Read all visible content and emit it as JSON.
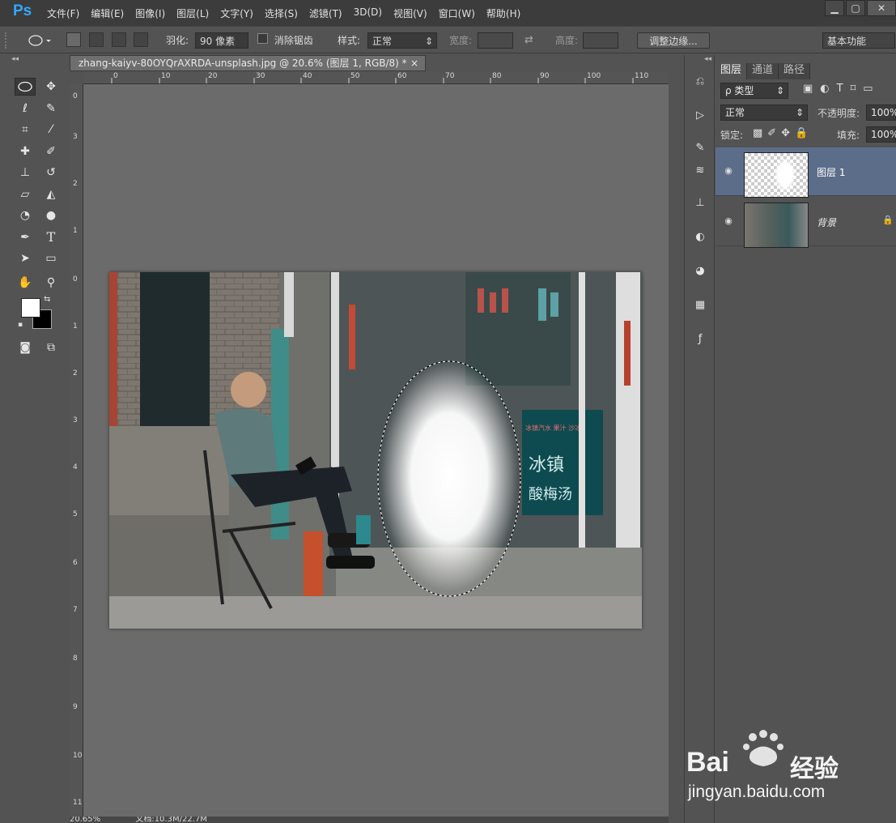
{
  "app": {
    "logo": "Ps",
    "menu": [
      "文件(F)",
      "编辑(E)",
      "图像(I)",
      "图层(L)",
      "文字(Y)",
      "选择(S)",
      "滤镜(T)",
      "3D(D)",
      "视图(V)",
      "窗口(W)",
      "帮助(H)"
    ],
    "window_buttons": [
      "▁",
      "▢",
      "✕"
    ]
  },
  "options": {
    "feather_label": "羽化:",
    "feather_value": "90 像素",
    "antialias_label": "消除锯齿",
    "style_label": "样式:",
    "style_value": "正常",
    "width_label": "宽度:",
    "height_label": "高度:",
    "refine_edge": "调整边缘...",
    "workspace": "基本功能"
  },
  "document": {
    "tab_title": "zhang-kaiyv-80OYQrAXRDA-unsplash.jpg  @ 20.6% (图层 1, RGB/8) *",
    "close": "×",
    "status": "20.65%",
    "status_doc": "文档:10.3M/22.7M",
    "ruler_top": [
      "0",
      "10",
      "20",
      "30",
      "40",
      "50",
      "60",
      "70",
      "80",
      "90",
      "100",
      "110"
    ],
    "ruler_left": [
      "0",
      "3",
      "2",
      "1",
      "0",
      "1",
      "2",
      "3",
      "4",
      "5",
      "6",
      "7",
      "8",
      "9",
      "10",
      "11"
    ],
    "shop_sign_1": "冰镇",
    "shop_sign_2": "酸梅汤",
    "shop_sign_3": "冰镇汽水 果汁 沙冰"
  },
  "layers_panel": {
    "tabs": [
      "图层",
      "通道",
      "路径"
    ],
    "filter_label": "ρ 类型",
    "blend_mode": "正常",
    "opacity_label": "不透明度:",
    "opacity_value": "100%",
    "lock_label": "锁定:",
    "fill_label": "填充:",
    "fill_value": "100%",
    "layers": [
      {
        "name": "图层 1",
        "selected": true
      },
      {
        "name": "背景",
        "locked": true
      }
    ]
  },
  "watermark": {
    "brand": "Bai",
    "brand_cn": "经验",
    "url": "jingyan.baidu.com"
  },
  "colors": {
    "ps_blue": "#31a8ff",
    "selected_layer": "#5c6d8a",
    "canvas_bg": "#6b6b6b"
  }
}
